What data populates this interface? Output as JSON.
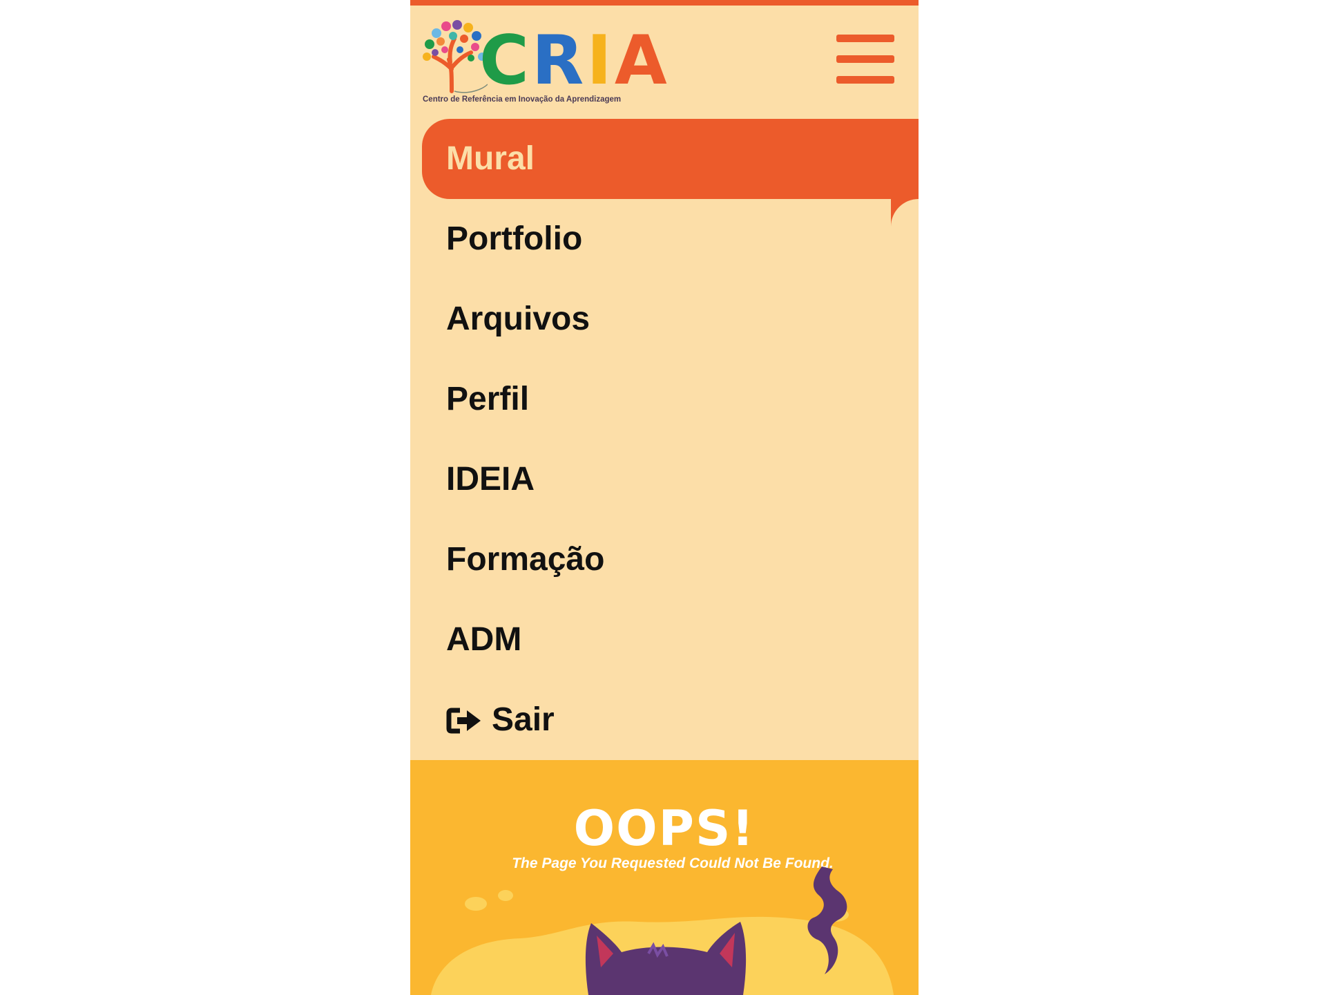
{
  "brand": {
    "logo_letters": [
      "C",
      "R",
      "I",
      "A"
    ],
    "logo_colors": [
      "#1f9b48",
      "#2a6fc4",
      "#f6b21d",
      "#ec5b2b"
    ],
    "tagline": "Centro de Referência em Inovação da Aprendizagem"
  },
  "header": {
    "menu_icon": "hamburger-icon"
  },
  "nav": {
    "items": [
      {
        "label": "Mural",
        "active": true
      },
      {
        "label": "Portfolio"
      },
      {
        "label": "Arquivos"
      },
      {
        "label": "Perfil"
      },
      {
        "label": "IDEIA"
      },
      {
        "label": "Formação"
      },
      {
        "label": "ADM"
      },
      {
        "label": "Sair",
        "icon": "sign-out-icon"
      }
    ]
  },
  "error": {
    "title": "OOPS!",
    "message": "The Page You Requested Could Not Be Found.",
    "illustration": "cat-illustration"
  },
  "colors": {
    "accent": "#ec5b2b",
    "menu_background": "#fcdea8",
    "error_background": "#fbb730",
    "cat": "#5b3570"
  }
}
